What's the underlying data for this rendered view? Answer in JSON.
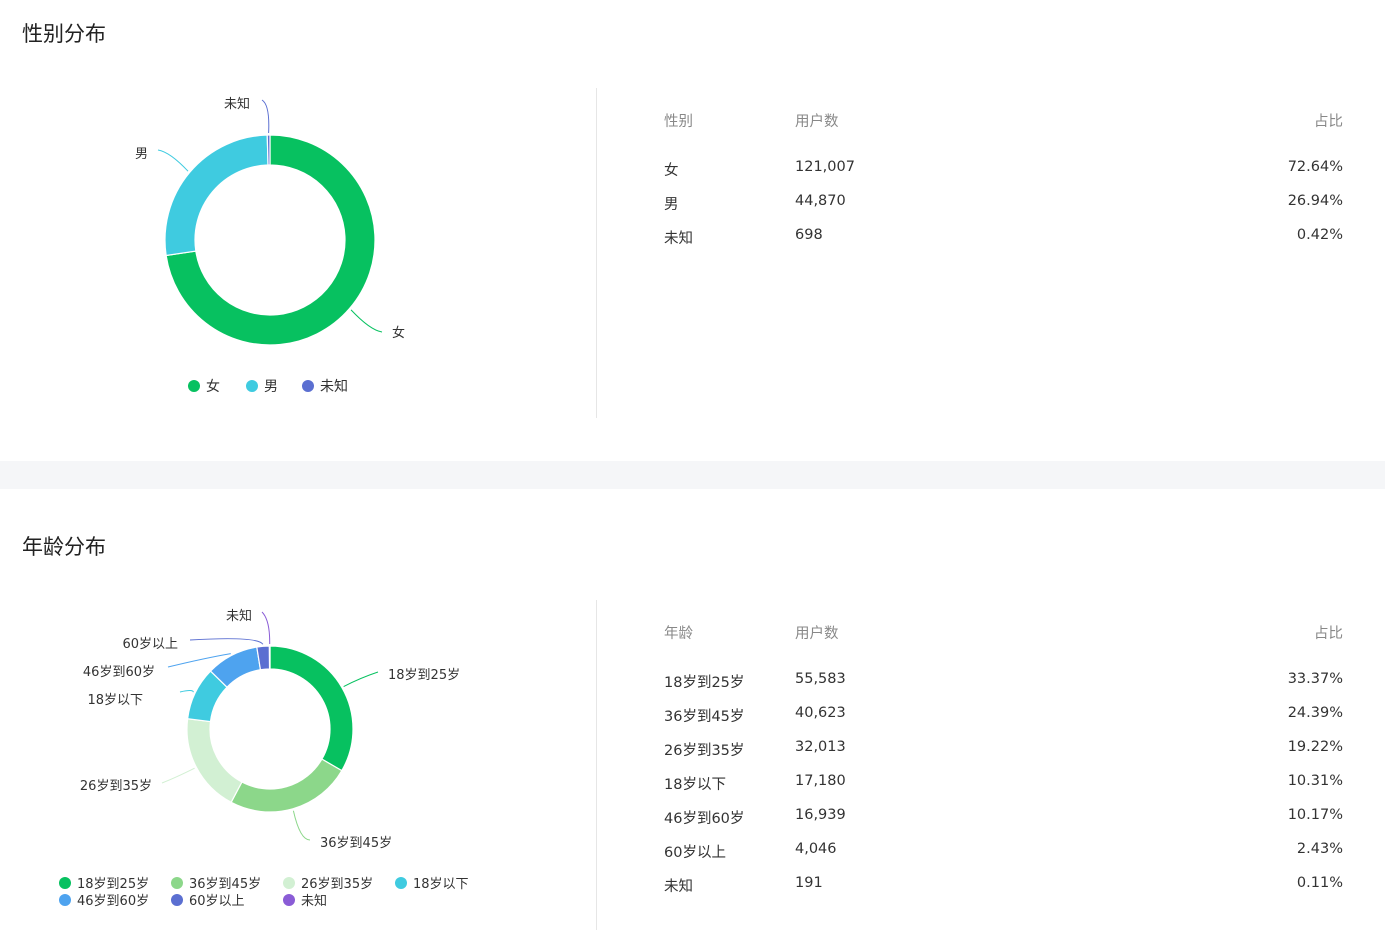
{
  "gender": {
    "title": "性别分布",
    "table_headers": [
      "性别",
      "用户数",
      "占比"
    ],
    "rows": [
      {
        "label": "女",
        "count": "121,007",
        "pct": "72.64%"
      },
      {
        "label": "男",
        "count": "44,870",
        "pct": "26.94%"
      },
      {
        "label": "未知",
        "count": "698",
        "pct": "0.42%"
      }
    ]
  },
  "age": {
    "title": "年龄分布",
    "table_headers": [
      "年龄",
      "用户数",
      "占比"
    ],
    "rows": [
      {
        "label": "18岁到25岁",
        "count": "55,583",
        "pct": "33.37%"
      },
      {
        "label": "36岁到45岁",
        "count": "40,623",
        "pct": "24.39%"
      },
      {
        "label": "26岁到35岁",
        "count": "32,013",
        "pct": "19.22%"
      },
      {
        "label": "18岁以下",
        "count": "17,180",
        "pct": "10.31%"
      },
      {
        "label": "46岁到60岁",
        "count": "16,939",
        "pct": "10.17%"
      },
      {
        "label": "60岁以上",
        "count": "4,046",
        "pct": "2.43%"
      },
      {
        "label": "未知",
        "count": "191",
        "pct": "0.11%"
      }
    ]
  },
  "chart_data": [
    {
      "type": "pie",
      "donut": true,
      "categories": [
        "女",
        "男",
        "未知"
      ],
      "values": [
        121007,
        44870,
        698
      ],
      "colors": [
        "#07c160",
        "#3fcbe0",
        "#5b6fd1"
      ],
      "legend_position": "bottom"
    },
    {
      "type": "pie",
      "donut": true,
      "categories": [
        "18岁到25岁",
        "36岁到45岁",
        "26岁到35岁",
        "18岁以下",
        "46岁到60岁",
        "60岁以上",
        "未知"
      ],
      "values": [
        55583,
        40623,
        32013,
        17180,
        16939,
        4046,
        191
      ],
      "colors": [
        "#07c160",
        "#8cd78a",
        "#d2f0d3",
        "#3fcbe0",
        "#4ea3ef",
        "#5b6fd1",
        "#8a5cd6"
      ],
      "legend_position": "bottom"
    }
  ]
}
